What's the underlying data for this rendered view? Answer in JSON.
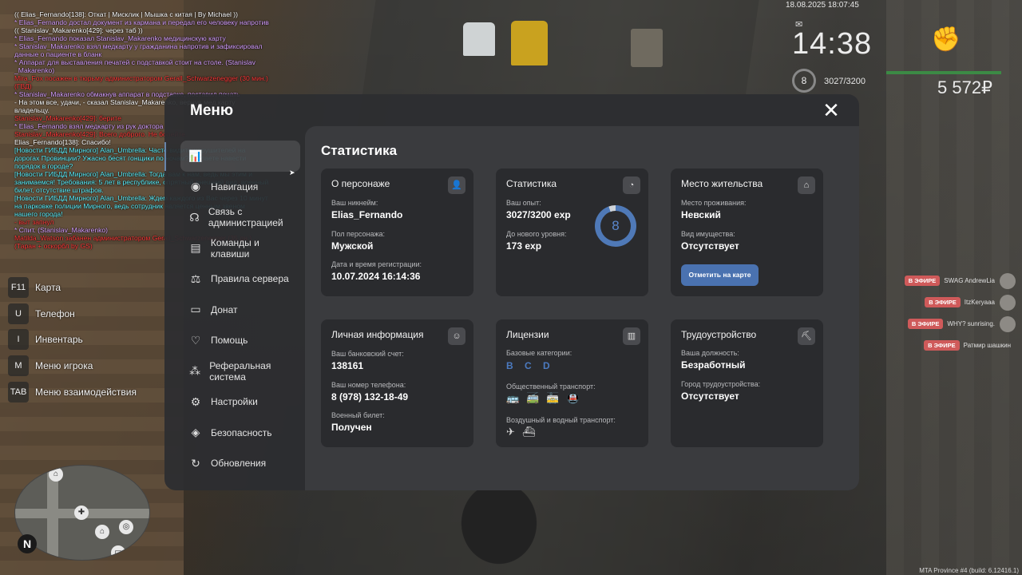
{
  "hud": {
    "datetime": "18.08.2025 18:07:45",
    "time": "14:38",
    "level": "8",
    "exp": "3027/3200",
    "money": "5 572₽"
  },
  "chat": [
    {
      "color": "w",
      "text": "(( Elias_Fernando[138]: Откат | Мисклик | Мышка с китая | By Michael ))"
    },
    {
      "color": "p",
      "text": "* Elias_Fernando достал документ из кармана и передал его человеку напротив"
    },
    {
      "color": "w",
      "text": "(( Stanislav_Makarenko[429]: через таб ))"
    },
    {
      "color": "p",
      "text": "* Elias_Fernando показал Stanislav_Makarenko медицинскую карту"
    },
    {
      "color": "p",
      "text": "* Stanislav_Makarenko взял медкарту у гражданина напротив и зафиксировал данные о пациенте в бланк"
    },
    {
      "color": "p",
      "text": "* Аппарат для выставления печатей с подставкой стоит на столе. (Stanislav _Makarenko)"
    },
    {
      "color": "r",
      "text": "Mira_Fox посажен в тюрьму администратором Gerall_Schwarzenegger (30 мин.) (ГВД)"
    },
    {
      "color": "p",
      "text": "* Stanislav_Makarenko обмакнув аппарат в подставке, поставил печать"
    },
    {
      "color": "w",
      "text": "- На этом все, удачи, - сказал Stanislav_Makarenko, вернув мед.карту владельцу."
    },
    {
      "color": "r",
      "text": "Stanislav_Makarenko[429]: берите"
    },
    {
      "color": "p",
      "text": "* Elias_Fernando взял медкарту из рук доктора"
    },
    {
      "color": "r",
      "text": "Stanislav_Makarenko[429]: Всего доброго. Не болейте."
    },
    {
      "color": "w",
      "text": "Elias_Fernando[138]: Спасибо!"
    },
    {
      "color": "c",
      "text": "[Новости ГИБДД Мирного] Alan_Umbrella: Часто видите нарушителей на дорогах Провинции? Ужасно бесят гонщики по ночам? Желаете навести порядок в городе?"
    },
    {
      "color": "c",
      "text": "[Новости ГИБДД Мирного] Alan_Umbrella: Тогда вам к нам, ведь мы этим и занимаемся! Требования: 5 лет в республике, опрятный внешний вид, военный билет, отсутствие штрафов."
    },
    {
      "color": "c",
      "text": "[Новости ГИБДД Мирного] Alan_Umbrella: Ждем каждого из Вас через 10 минут на парковке полиции Мирного, ведь сотрудник является ценным звеном нашего города!"
    },
    {
      "color": "r",
      "text": "- выт запнул"
    },
    {
      "color": "p",
      "text": "* Спит. (Stanislav_Makarenko)"
    },
    {
      "color": "r",
      "text": "Matilda_Watson забанен администратором Gerall_Schwarzenegger (35 дн.) (Таран + оскорбл by GS)"
    }
  ],
  "hotkeys": [
    {
      "key": "F11",
      "label": "Карта"
    },
    {
      "key": "U",
      "label": "Телефон"
    },
    {
      "key": "I",
      "label": "Инвентарь"
    },
    {
      "key": "M",
      "label": "Меню игрока"
    },
    {
      "key": "TAB",
      "label": "Меню взаимодействия"
    }
  ],
  "broadcasts": [
    {
      "badge": "В ЭФИРЕ",
      "name": "SWAG AndrewLia"
    },
    {
      "badge": "В ЭФИРЕ",
      "name": "ItzKeryaaa"
    },
    {
      "badge": "В ЭФИРЕ",
      "name": "WHY? sunrising."
    },
    {
      "badge": "В ЭФИРЕ",
      "name": "Ратмир шашкин"
    }
  ],
  "footer": "MTA Province #4 (build: 6.12416.1)",
  "menu": {
    "title": "Меню",
    "nav": [
      {
        "icon": "📊",
        "label": ""
      },
      {
        "icon": "◉",
        "label": "Навигация"
      },
      {
        "icon": "☊",
        "label": "Связь с администрацией"
      },
      {
        "icon": "▤",
        "label": "Команды и клавиши"
      },
      {
        "icon": "⚖",
        "label": "Правила сервера"
      },
      {
        "icon": "▭",
        "label": "Донат"
      },
      {
        "icon": "♡",
        "label": "Помощь"
      },
      {
        "icon": "⁂",
        "label": "Реферальная система"
      },
      {
        "icon": "⚙",
        "label": "Настройки"
      },
      {
        "icon": "◈",
        "label": "Безопасность"
      },
      {
        "icon": "↻",
        "label": "Обновления"
      }
    ]
  },
  "stats": {
    "title": "Статистика",
    "character": {
      "title": "О персонаже",
      "icon": "user-icon",
      "nick_label": "Ваш никнейм:",
      "nick": "Elias_Fernando",
      "gender_label": "Пол персонажа:",
      "gender": "Мужской",
      "reg_label": "Дата и время регистрации:",
      "reg": "10.07.2024 16:14:36"
    },
    "statistics": {
      "title": "Статистика",
      "icon": "pie-chart-icon",
      "exp_label": "Ваш опыт:",
      "exp": "3027/3200 exp",
      "next_label": "До нового уровня:",
      "next": "173 exp",
      "level": "8",
      "progress": 0.946
    },
    "residence": {
      "title": "Место жительства",
      "icon": "house-icon",
      "place_label": "Место проживания:",
      "place": "Невский",
      "property_label": "Вид имущества:",
      "property": "Отсутствует",
      "button": "Отметить на карте"
    },
    "personal": {
      "title": "Личная информация",
      "icon": "face-icon",
      "bank_label": "Ваш банковский счет:",
      "bank": "138161",
      "phone_label": "Ваш номер телефона:",
      "phone": "8 (978) 132-18-49",
      "military_label": "Военный билет:",
      "military": "Получен"
    },
    "licenses": {
      "title": "Лицензии",
      "icon": "id-card-icon",
      "base_label": "Базовые категории:",
      "categories": [
        "B",
        "C",
        "D"
      ],
      "public_label": "Общественный транспорт:",
      "air_label": "Воздушный и водный транспорт:"
    },
    "employment": {
      "title": "Трудоустройство",
      "icon": "pickaxe-icon",
      "position_label": "Ваша должность:",
      "position": "Безработный",
      "city_label": "Город трудоустройства:",
      "city": "Отсутствует"
    }
  }
}
